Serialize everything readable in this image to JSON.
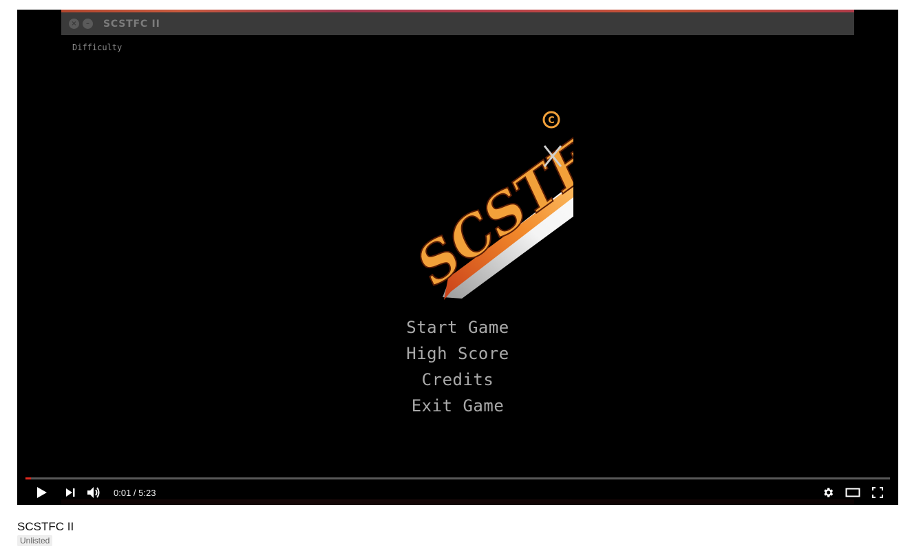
{
  "game_window": {
    "title": "SCSTFC II",
    "menu_label": "Difficulty",
    "logo_text": "SCSTFCII",
    "menu_items": [
      "Start Game",
      "High Score",
      "Credits",
      "Exit Game"
    ]
  },
  "player": {
    "current_time": "0:01",
    "separator": " / ",
    "duration": "5:23",
    "progress_fraction": 0.003,
    "accent": "#e22a1f",
    "icons": [
      "play-icon",
      "next-icon",
      "volume-icon",
      "settings-gear-icon",
      "theater-mode-icon",
      "fullscreen-icon"
    ]
  },
  "video": {
    "title": "SCSTFC II",
    "visibility_badge": "Unlisted"
  }
}
